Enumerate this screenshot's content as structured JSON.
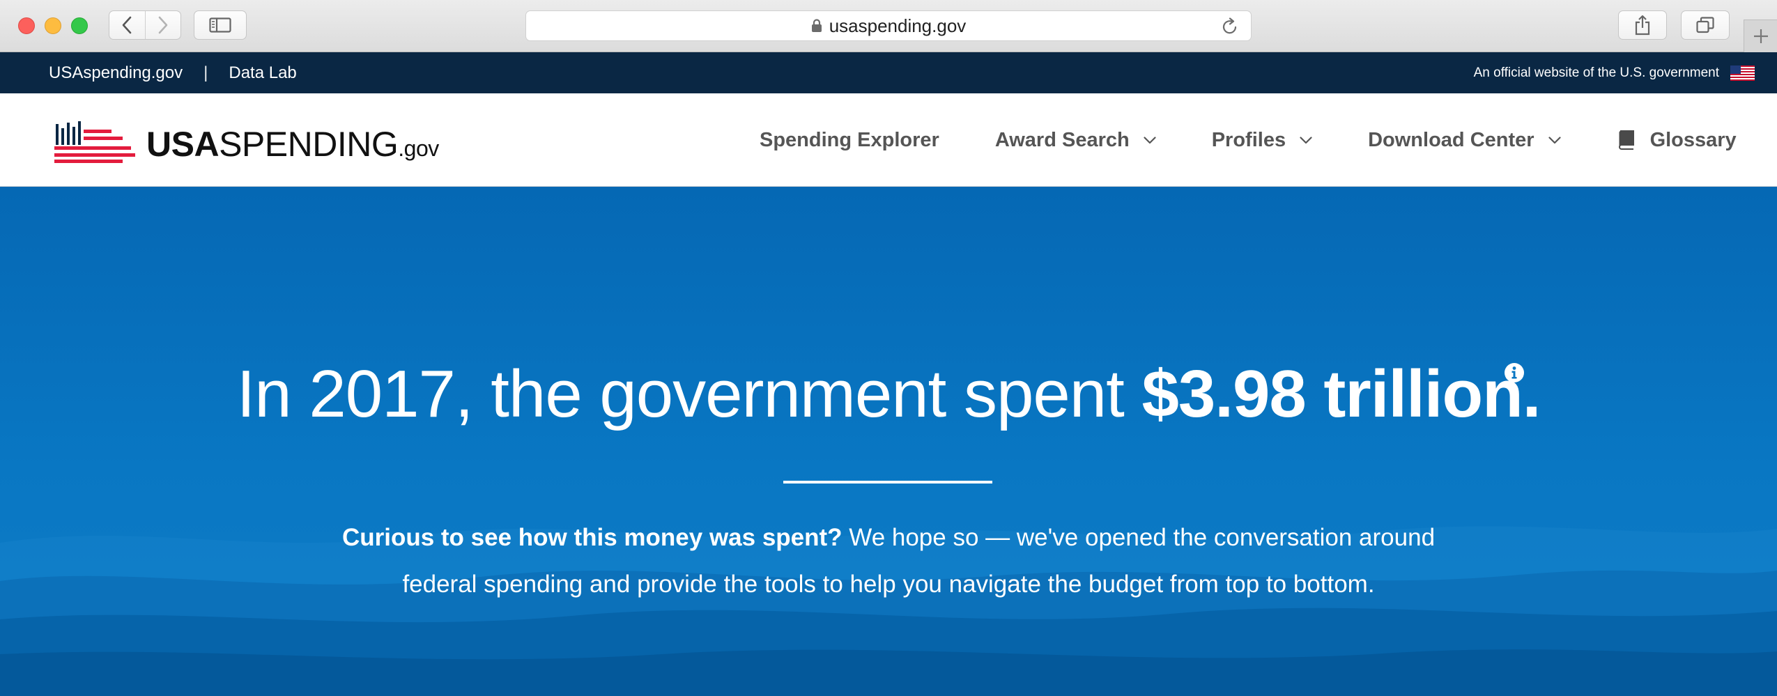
{
  "browser": {
    "url": "usaspending.gov",
    "icons": [
      "back-icon",
      "forward-icon",
      "sidebar-icon",
      "lock-icon",
      "reload-icon",
      "share-icon",
      "tabs-icon",
      "new-tab-icon"
    ]
  },
  "gov_bar": {
    "site_link": "USAspending.gov",
    "separator": "|",
    "data_lab_link": "Data Lab",
    "official_text": "An official website of the U.S. government",
    "flag_icon": "us-flag-icon"
  },
  "header": {
    "logo": {
      "bold": "USA",
      "light": "SPENDING",
      "suffix": ".gov",
      "icon": "usaspending-logo-icon"
    },
    "nav": [
      {
        "label": "Spending Explorer"
      },
      {
        "label": "Award Search",
        "icon": "chevron-down-icon"
      },
      {
        "label": "Profiles",
        "icon": "chevron-down-icon"
      },
      {
        "label": "Download Center",
        "icon": "chevron-down-icon"
      },
      {
        "label": "Glossary",
        "icon": "book-icon"
      }
    ]
  },
  "hero": {
    "headline_prefix": "In 2017, the government spent ",
    "headline_amount": "$3.98 trillion",
    "headline_period": ".",
    "info_icon": "info-icon",
    "lede_bold": "Curious to see how this money was spent?",
    "lede_text": " We hope so — we've opened the conversation around federal spending and provide the tools to help you navigate the budget from top to bottom."
  },
  "colors": {
    "gov_bar": "#0a2744",
    "hero_blue": "#0977c3",
    "logo_red": "#e31c3d",
    "logo_navy": "#0a2744",
    "nav_text": "#555555"
  }
}
